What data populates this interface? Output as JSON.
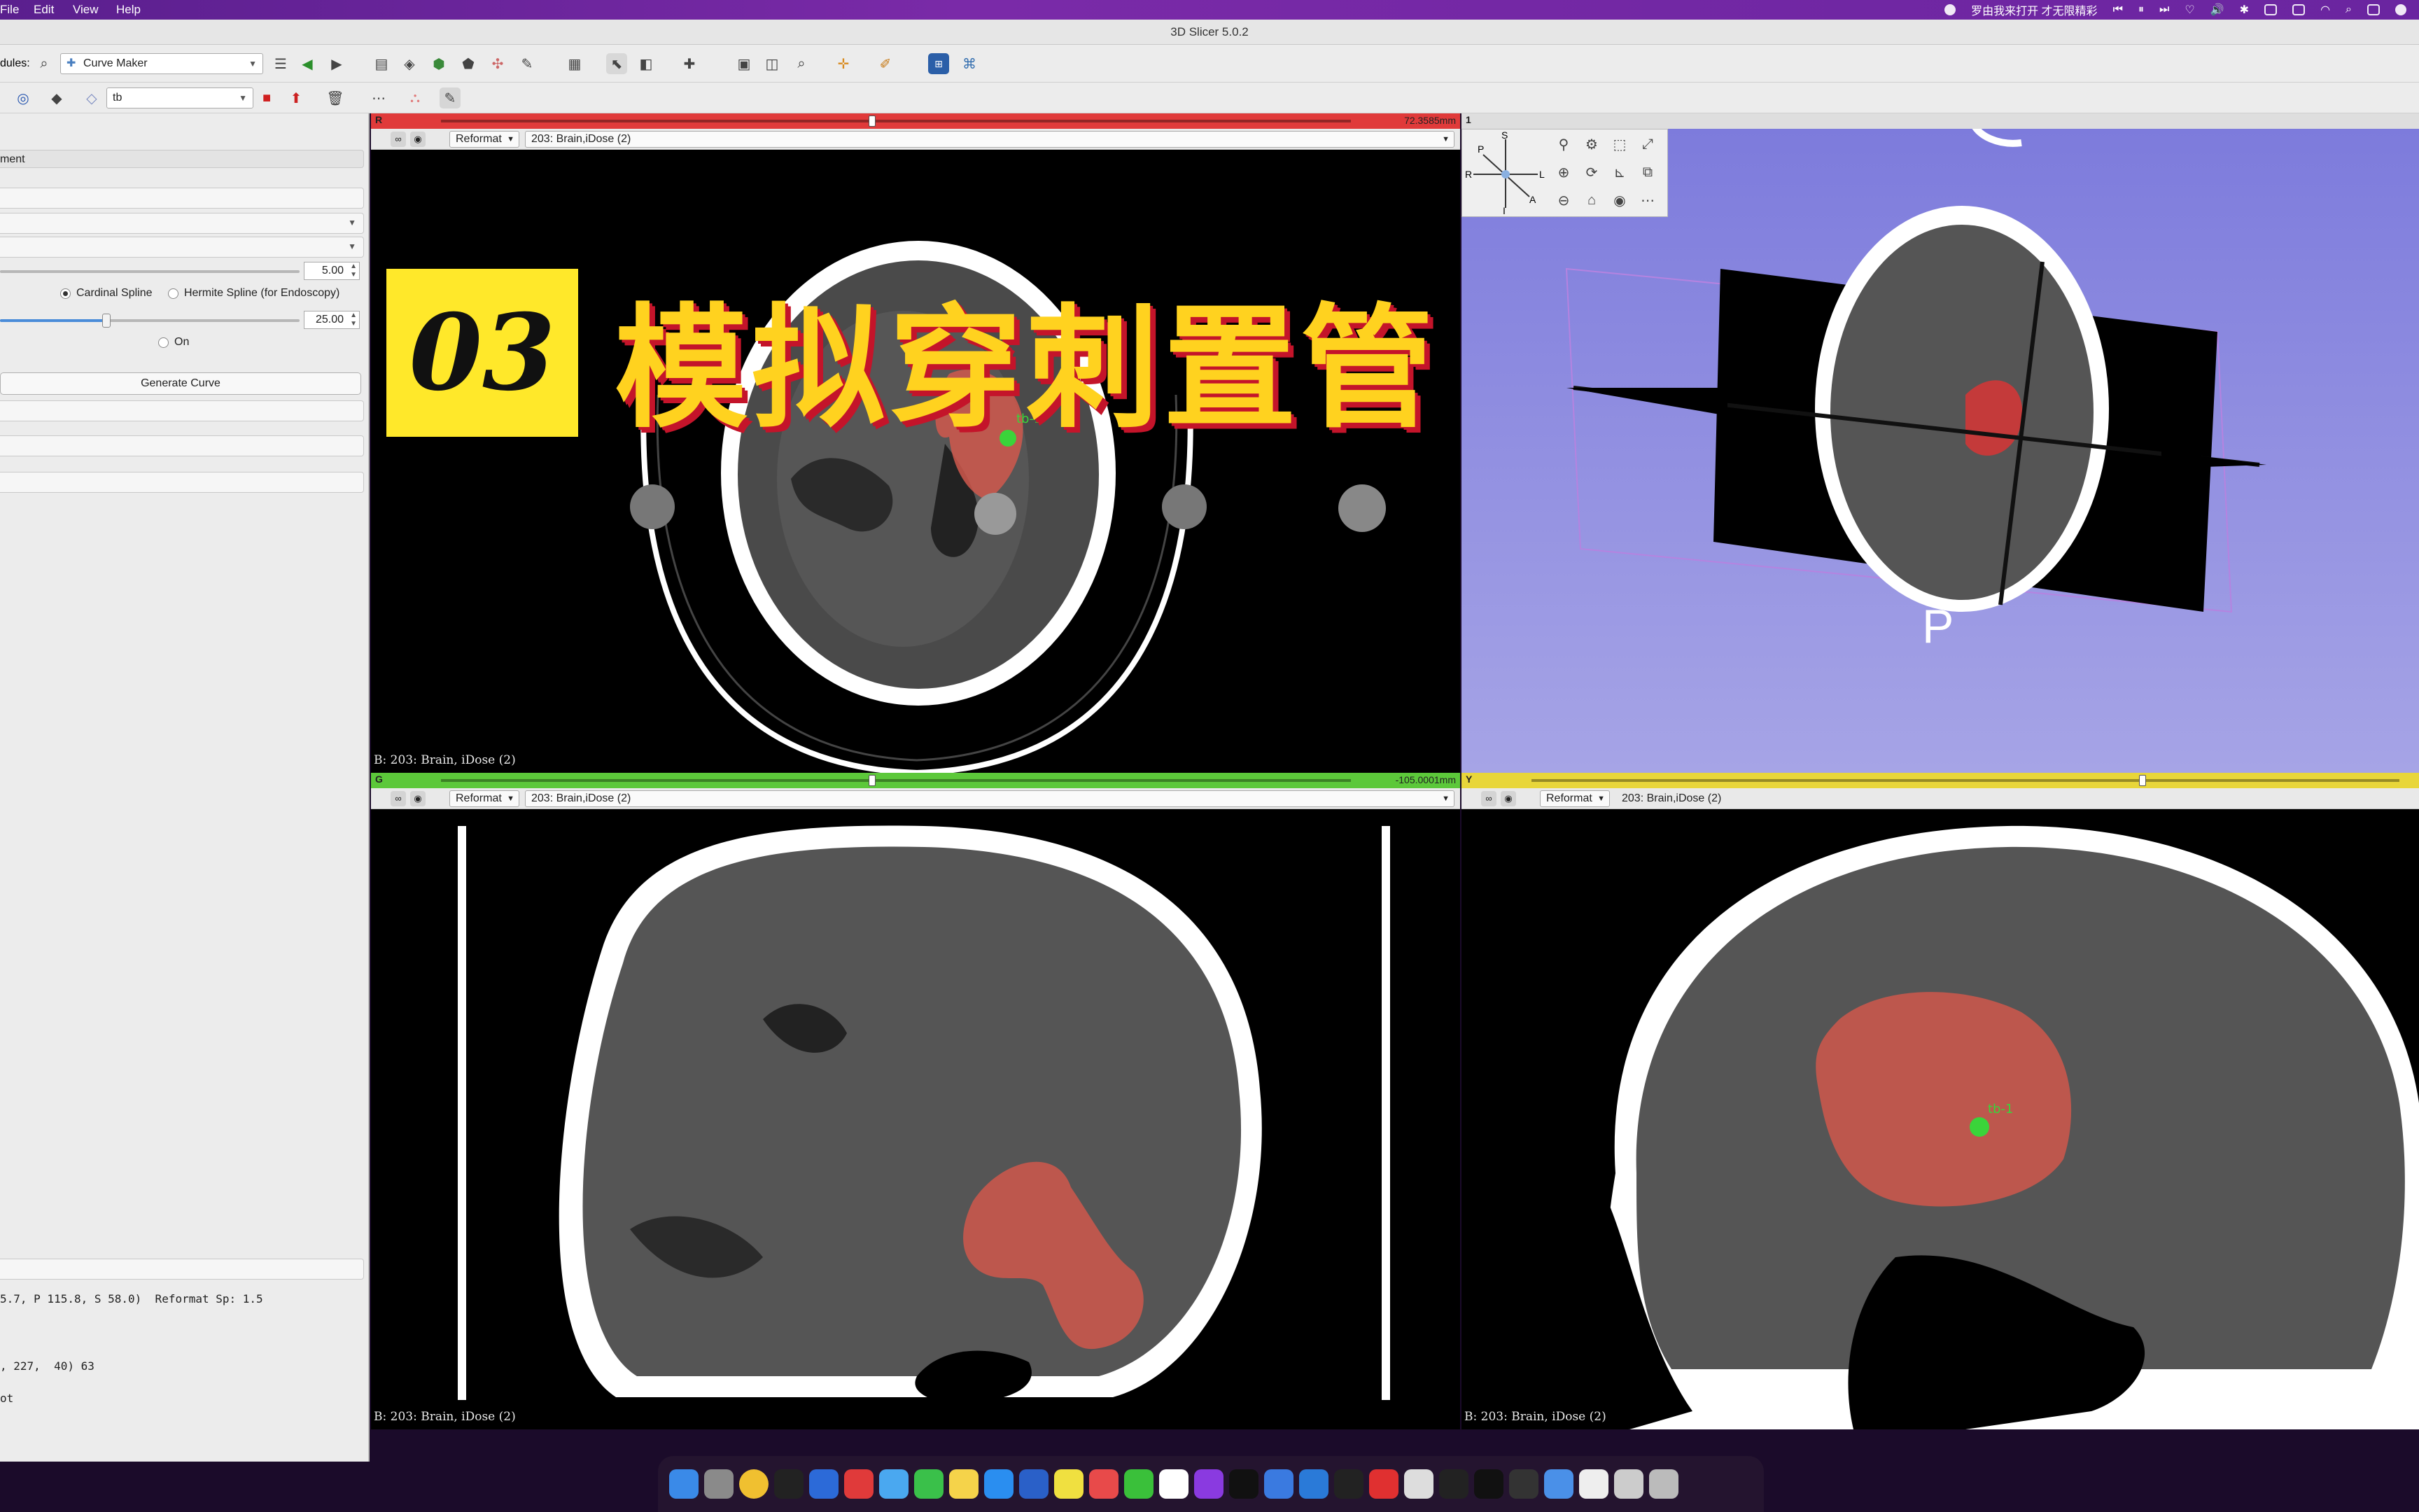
{
  "menubar": {
    "items": [
      "File",
      "Edit",
      "View",
      "Help"
    ],
    "now_playing": "罗由我来打开 才无限精彩"
  },
  "window": {
    "title": "3D Slicer 5.0.2"
  },
  "toolbar": {
    "modules_label": "dules:",
    "module_name": "Curve Maker",
    "node_name": "tb"
  },
  "left_panel": {
    "row1_text": "ment",
    "spin_resolution": "5.00",
    "radio_cardinal": "Cardinal Spline",
    "radio_hermite": "Hermite Spline (for Endoscopy)",
    "spin_radius": "25.00",
    "toggle_on": "On",
    "generate_button": "Generate Curve",
    "info_line1": "5.7, P 115.8, S 58.0)  Reformat Sp: 1.5",
    "info_line2": ", 227,  40) 63",
    "info_line3": "ot"
  },
  "views": {
    "red": {
      "letter": "R",
      "offset": "72.3585mm",
      "mode": "Reformat",
      "volume": "203: Brain,iDose (2)",
      "corner": "B: 203: Brain, iDose (2)",
      "slider_fraction": 0.47,
      "fiducial": "tb-1"
    },
    "green": {
      "letter": "G",
      "offset": "-105.0001mm",
      "mode": "Reformat",
      "volume": "203: Brain,iDose (2)",
      "corner": "B: 203: Brain, iDose (2)",
      "slider_fraction": 0.47
    },
    "yellow": {
      "letter": "Y",
      "mode": "Reformat",
      "volume": "203: Brain,iDose (2)",
      "corner": "B: 203: Brain, iDose (2)",
      "slider_fraction": 0.7,
      "fiducial": "tb-1"
    },
    "threed": {
      "letter": "1",
      "orientation_label": "P",
      "cube_labels": [
        "S",
        "P",
        "R",
        "L",
        "A",
        "I"
      ]
    }
  },
  "overlay": {
    "number": "03",
    "title": "模拟穿刺置管"
  },
  "colors": {
    "red_bar": "#e03a3a",
    "green_bar": "#5cc83a",
    "yellow_bar": "#e8d63a",
    "threed_bg": "#8f8ce0",
    "hematoma": "#d0584c",
    "badge": "#ffe82a",
    "title_fill": "#ffd21f",
    "title_shadow": "#c4142a"
  }
}
